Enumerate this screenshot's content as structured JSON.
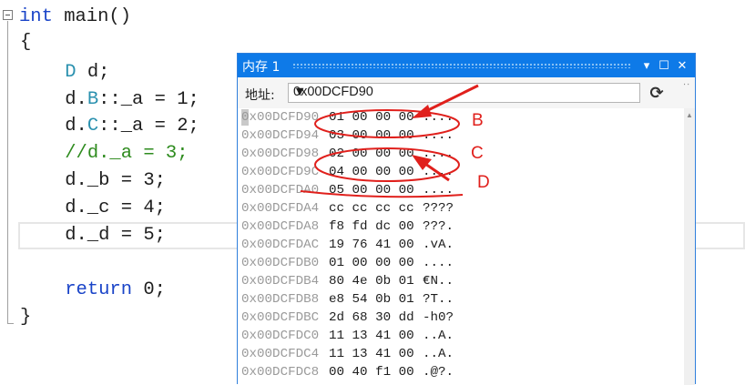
{
  "code": {
    "lines": [
      {
        "parts": [
          {
            "t": "int",
            "c": "kw"
          },
          {
            "t": " main()",
            "c": ""
          }
        ]
      },
      {
        "parts": [
          {
            "t": "{",
            "c": ""
          }
        ]
      },
      {
        "parts": [
          {
            "t": "    ",
            "c": ""
          },
          {
            "t": "D",
            "c": "cls"
          },
          {
            "t": " d;",
            "c": ""
          }
        ]
      },
      {
        "parts": [
          {
            "t": "    d.",
            "c": ""
          },
          {
            "t": "B",
            "c": "cls"
          },
          {
            "t": "::_a = 1;",
            "c": ""
          }
        ]
      },
      {
        "parts": [
          {
            "t": "    d.",
            "c": ""
          },
          {
            "t": "C",
            "c": "cls"
          },
          {
            "t": "::_a = 2;",
            "c": ""
          }
        ]
      },
      {
        "parts": [
          {
            "t": "    ",
            "c": ""
          },
          {
            "t": "//d._a = 3;",
            "c": "cmt"
          }
        ]
      },
      {
        "parts": [
          {
            "t": "    d._b = 3;",
            "c": ""
          }
        ]
      },
      {
        "parts": [
          {
            "t": "    d._c = 4;",
            "c": ""
          }
        ]
      },
      {
        "parts": [
          {
            "t": "    d._d = 5;",
            "c": ""
          }
        ]
      },
      {
        "parts": [
          {
            "t": "",
            "c": ""
          }
        ]
      },
      {
        "parts": [
          {
            "t": "    ",
            "c": ""
          },
          {
            "t": "return",
            "c": "kw"
          },
          {
            "t": " 0;",
            "c": ""
          }
        ]
      },
      {
        "parts": [
          {
            "t": "}",
            "c": ""
          }
        ]
      }
    ]
  },
  "memory_window": {
    "title": "内存 1",
    "buttons": {
      "dropdown": "▾",
      "maximize": "☐",
      "close": "✕"
    },
    "address_label": "地址:",
    "address_value": "0x00DCFD90",
    "refresh_icon": "refresh-icon",
    "rows": [
      {
        "addr": "0x00DCFD90",
        "bytes": "01 00 00 00",
        "ascii": "...."
      },
      {
        "addr": "0x00DCFD94",
        "bytes": "03 00 00 00",
        "ascii": "...."
      },
      {
        "addr": "0x00DCFD98",
        "bytes": "02 00 00 00",
        "ascii": "...."
      },
      {
        "addr": "0x00DCFD9C",
        "bytes": "04 00 00 00",
        "ascii": "...."
      },
      {
        "addr": "0x00DCFDA0",
        "bytes": "05 00 00 00",
        "ascii": "...."
      },
      {
        "addr": "0x00DCFDA4",
        "bytes": "cc cc cc cc",
        "ascii": "????"
      },
      {
        "addr": "0x00DCFDA8",
        "bytes": "f8 fd dc 00",
        "ascii": "???."
      },
      {
        "addr": "0x00DCFDAC",
        "bytes": "19 76 41 00",
        "ascii": ".vA."
      },
      {
        "addr": "0x00DCFDB0",
        "bytes": "01 00 00 00",
        "ascii": "...."
      },
      {
        "addr": "0x00DCFDB4",
        "bytes": "80 4e 0b 01",
        "ascii": "€N.."
      },
      {
        "addr": "0x00DCFDB8",
        "bytes": "e8 54 0b 01",
        "ascii": "?T.."
      },
      {
        "addr": "0x00DCFDBC",
        "bytes": "2d 68 30 dd",
        "ascii": "-h0?"
      },
      {
        "addr": "0x00DCFDC0",
        "bytes": "11 13 41 00",
        "ascii": "..A."
      },
      {
        "addr": "0x00DCFDC4",
        "bytes": "11 13 41 00",
        "ascii": "..A."
      },
      {
        "addr": "0x00DCFDC8",
        "bytes": "00 40 f1 00",
        "ascii": ".@?."
      }
    ]
  },
  "annotations": {
    "color": "#e0201c",
    "labels": [
      "B",
      "C",
      "D"
    ]
  },
  "colors": {
    "title_bar": "#0e7ae8",
    "keyword": "#1a44c8",
    "class_name": "#2b91af",
    "comment": "#2e8b1e",
    "address_text": "#9a9a9a"
  }
}
